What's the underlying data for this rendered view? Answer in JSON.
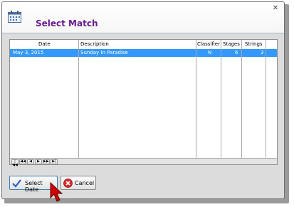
{
  "window": {
    "title": "Select Match",
    "close_glyph": "✕",
    "icon": "calendar-icon"
  },
  "grid": {
    "columns": [
      "Date",
      "Description",
      "Classifier",
      "Stages",
      "Strings"
    ],
    "rows": [
      {
        "date": "May  3, 2015",
        "description": "Sunday In Paradise",
        "classifier": "N",
        "stages": "6",
        "strings": "3",
        "selected": true
      }
    ],
    "navigator": [
      "|◀◀",
      "◀◀",
      "◀",
      "▶",
      "▶▶",
      "▶|"
    ]
  },
  "buttons": {
    "select_label": "Select Date",
    "cancel_label": "Cancel"
  },
  "colors": {
    "title": "#6a1c93",
    "selection": "#3399ff",
    "cursor": "#cc0000"
  }
}
